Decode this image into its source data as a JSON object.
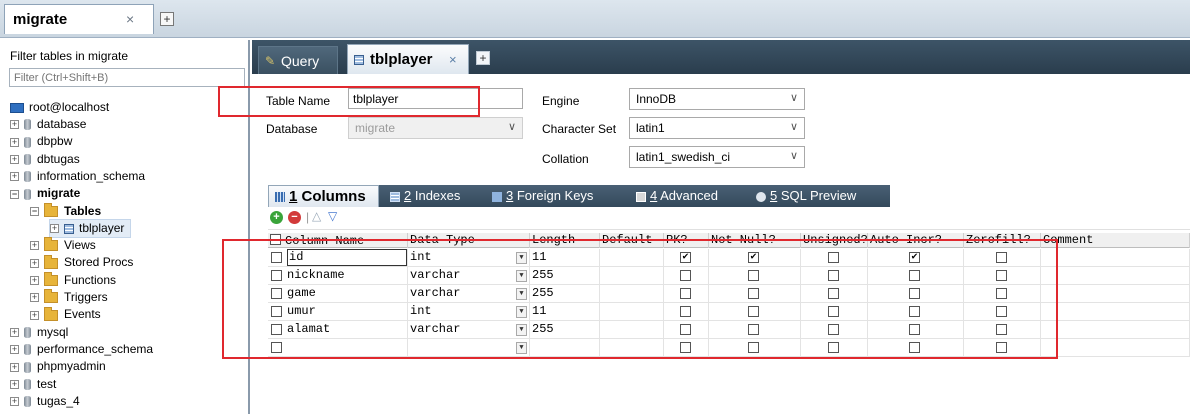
{
  "connection_tab": {
    "label": "migrate",
    "close": "×",
    "add": "+"
  },
  "browser": {
    "filter_label": "Filter tables in migrate",
    "filter_placeholder": "Filter (Ctrl+Shift+B)",
    "server": "root@localhost",
    "items": [
      {
        "label": "database",
        "level": 0,
        "icon": "database-icon",
        "expander": "+"
      },
      {
        "label": "dbpbw",
        "level": 0,
        "icon": "database-icon",
        "expander": "+"
      },
      {
        "label": "dbtugas",
        "level": 0,
        "icon": "database-icon",
        "expander": "+"
      },
      {
        "label": "information_schema",
        "level": 0,
        "icon": "database-icon",
        "expander": "+"
      },
      {
        "label": "migrate",
        "level": 0,
        "icon": "database-icon",
        "expander": "−"
      },
      {
        "label": "Tables",
        "level": 1,
        "icon": "folder-icon",
        "expander": "−"
      },
      {
        "label": "tblplayer",
        "level": 2,
        "icon": "table-icon",
        "expander": "+"
      },
      {
        "label": "Views",
        "level": 1,
        "icon": "folder-icon",
        "expander": "+"
      },
      {
        "label": "Stored Procs",
        "level": 1,
        "icon": "folder-icon",
        "expander": "+"
      },
      {
        "label": "Functions",
        "level": 1,
        "icon": "folder-icon",
        "expander": "+"
      },
      {
        "label": "Triggers",
        "level": 1,
        "icon": "folder-icon",
        "expander": "+"
      },
      {
        "label": "Events",
        "level": 1,
        "icon": "folder-icon",
        "expander": "+"
      },
      {
        "label": "mysql",
        "level": 0,
        "icon": "database-icon",
        "expander": "+"
      },
      {
        "label": "performance_schema",
        "level": 0,
        "icon": "database-icon",
        "expander": "+"
      },
      {
        "label": "phpmyadmin",
        "level": 0,
        "icon": "database-icon",
        "expander": "+"
      },
      {
        "label": "test",
        "level": 0,
        "icon": "database-icon",
        "expander": "+"
      },
      {
        "label": "tugas_4",
        "level": 0,
        "icon": "database-icon",
        "expander": "+"
      }
    ]
  },
  "query_tabs": {
    "query_label": "Query",
    "table_tab_label": "tblplayer",
    "close": "×",
    "add": "+"
  },
  "form": {
    "table_name_label": "Table Name",
    "table_name_value": "tblplayer",
    "database_label": "Database",
    "database_value": "migrate",
    "engine_label": "Engine",
    "engine_value": "InnoDB",
    "charset_label": "Character Set",
    "charset_value": "latin1",
    "collation_label": "Collation",
    "collation_value": "latin1_swedish_ci",
    "arrow": "∨"
  },
  "subtabs": [
    {
      "num": "1",
      "label": " Columns"
    },
    {
      "num": "2",
      "label": " Indexes"
    },
    {
      "num": "3",
      "label": " Foreign Keys"
    },
    {
      "num": "4",
      "label": " Advanced"
    },
    {
      "num": "5",
      "label": " SQL Preview"
    }
  ],
  "toolbar": {
    "add": "+",
    "remove": "−",
    "up": "△",
    "down": "▽"
  },
  "grid": {
    "headers": [
      "Column Name",
      "Data Type",
      "Length",
      "Default",
      "PK?",
      "Not Null?",
      "Unsigned?",
      "Auto Incr?",
      "Zerofill?",
      "Comment"
    ],
    "rows": [
      {
        "name": "id",
        "type": "int",
        "length": "11",
        "default": "",
        "pk": true,
        "notnull": true,
        "unsigned": false,
        "autoinc": true,
        "zerofill": false,
        "comment": ""
      },
      {
        "name": "nickname",
        "type": "varchar",
        "length": "255",
        "default": "",
        "pk": false,
        "notnull": false,
        "unsigned": false,
        "autoinc": false,
        "zerofill": false,
        "comment": ""
      },
      {
        "name": "game",
        "type": "varchar",
        "length": "255",
        "default": "",
        "pk": false,
        "notnull": false,
        "unsigned": false,
        "autoinc": false,
        "zerofill": false,
        "comment": ""
      },
      {
        "name": "umur",
        "type": "int",
        "length": "11",
        "default": "",
        "pk": false,
        "notnull": false,
        "unsigned": false,
        "autoinc": false,
        "zerofill": false,
        "comment": ""
      },
      {
        "name": "alamat",
        "type": "varchar",
        "length": "255",
        "default": "",
        "pk": false,
        "notnull": false,
        "unsigned": false,
        "autoinc": false,
        "zerofill": false,
        "comment": ""
      },
      {
        "name": "",
        "type": "",
        "length": "",
        "default": "",
        "pk": false,
        "notnull": false,
        "unsigned": false,
        "autoinc": false,
        "zerofill": false,
        "comment": ""
      }
    ],
    "checkmark": "✔",
    "dropdown": "▼"
  },
  "colors": {
    "highlight_red": "#e0282e",
    "tab_dark": "#2a3d4d"
  }
}
